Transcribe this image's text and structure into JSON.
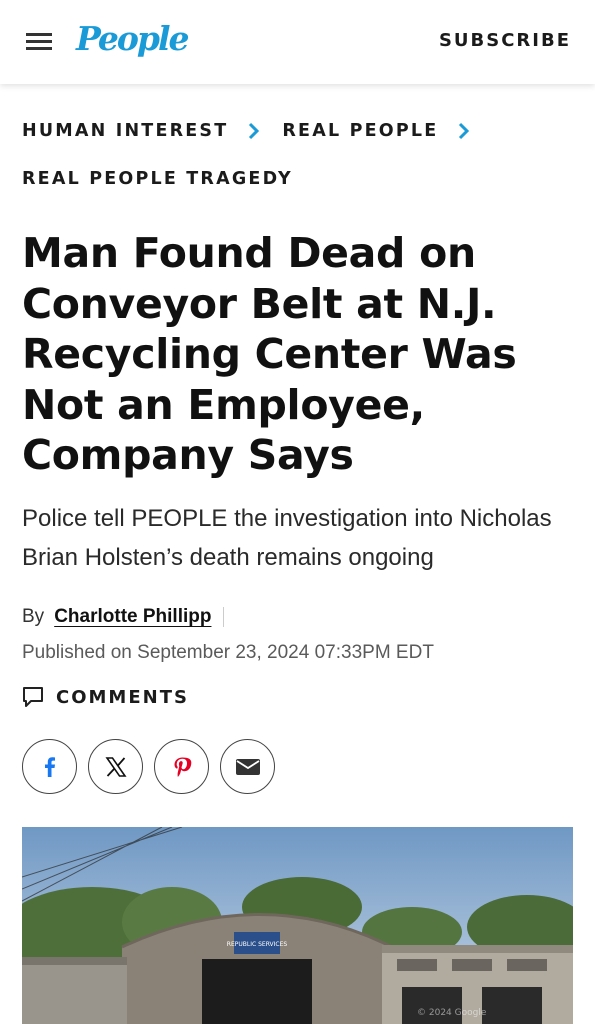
{
  "header": {
    "logo": "People",
    "subscribe_label": "SUBSCRIBE"
  },
  "breadcrumb": {
    "items": [
      "HUMAN INTEREST",
      "REAL PEOPLE"
    ],
    "subcategory": "REAL PEOPLE TRAGEDY"
  },
  "article": {
    "headline": "Man Found Dead on Conveyor Belt at N.J. Recycling Center Was Not an Employee, Company Says",
    "dek": "Police tell PEOPLE the investigation into Nicholas Brian Holsten’s death remains ongoing",
    "by_label": "By",
    "author": "Charlotte Phillipp",
    "published": "Published on September 23, 2024 07:33PM EDT",
    "comments_label": "COMMENTS"
  },
  "share": {
    "buttons": [
      "facebook-icon",
      "x-icon",
      "pinterest-icon",
      "email-icon"
    ]
  },
  "photo": {
    "sign_text": "REPUBLIC SERVICES",
    "watermark": "© 2024 Google",
    "colors": {
      "sky": "#7fa3c9",
      "building": "#8a8276",
      "trees": "#4f6f3a"
    }
  },
  "colors": {
    "brand": "#1a9bd7",
    "pinterest": "#e60023",
    "facebook": "#1877f2"
  }
}
